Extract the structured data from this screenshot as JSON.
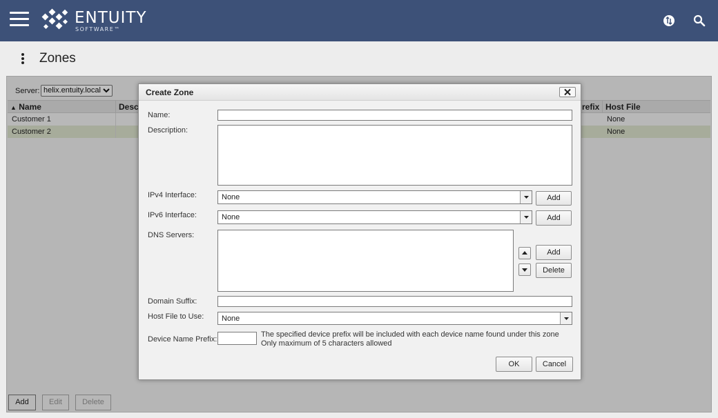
{
  "header": {
    "brand_name": "ENTUITY",
    "brand_sub": "SOFTWARE™",
    "menu_icon": "hamburger-menu-icon",
    "sync_icon": "sync-icon",
    "search_icon": "search-icon",
    "bg_color": "#3d5178"
  },
  "page": {
    "title": "Zones"
  },
  "toolbar": {
    "server_label": "Server:",
    "server_value": "helix.entuity.local"
  },
  "table": {
    "columns": [
      "Name",
      "Desc",
      "refix",
      "Host File"
    ],
    "sort_indicator": "▲",
    "rows": [
      {
        "name": "Customer 1",
        "host_file": "None"
      },
      {
        "name": "Customer 2",
        "host_file": "None"
      }
    ]
  },
  "bottom_buttons": {
    "add": "Add",
    "edit": "Edit",
    "delete": "Delete"
  },
  "dialog": {
    "title": "Create Zone",
    "close_icon": "close-icon",
    "name_label": "Name:",
    "name_value": "",
    "description_label": "Description:",
    "description_value": "",
    "ipv4_label": "IPv4 Interface:",
    "ipv4_value": "None",
    "ipv4_add": "Add",
    "ipv6_label": "IPv6 Interface:",
    "ipv6_value": "None",
    "ipv6_add": "Add",
    "dns_label": "DNS Servers:",
    "dns_add": "Add",
    "dns_delete": "Delete",
    "domain_suffix_label": "Domain Suffix:",
    "domain_suffix_value": "",
    "host_file_label": "Host File to Use:",
    "host_file_value": "None",
    "prefix_label": "Device Name Prefix:",
    "prefix_value": "",
    "prefix_hint_1": "The specified device prefix will be included with each device name found under this zone",
    "prefix_hint_2": "Only maximum of 5 characters allowed",
    "ok": "OK",
    "cancel": "Cancel"
  }
}
